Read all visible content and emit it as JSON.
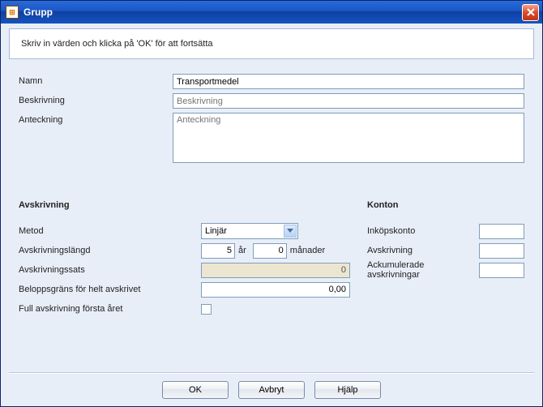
{
  "window": {
    "title": "Grupp"
  },
  "instruction": "Skriv in värden och klicka på 'OK' för att fortsätta",
  "labels": {
    "namn": "Namn",
    "beskrivning": "Beskrivning",
    "anteckning": "Anteckning"
  },
  "values": {
    "namn": "Transportmedel",
    "beskrivning": "",
    "anteckning": ""
  },
  "placeholders": {
    "beskrivning": "Beskrivning",
    "anteckning": "Anteckning"
  },
  "avskrivning": {
    "title": "Avskrivning",
    "metod_label": "Metod",
    "metod_value": "Linjär",
    "langd_label": "Avskrivningslängd",
    "ar_value": "5",
    "ar_unit": "år",
    "man_value": "0",
    "man_unit": "månader",
    "sats_label": "Avskrivningssats",
    "sats_value": "0",
    "belopp_label": "Beloppsgräns för helt avskrivet",
    "belopp_value": "0,00",
    "full_label": "Full avskrivning första året",
    "full_checked": false
  },
  "konton": {
    "title": "Konton",
    "inkop_label": "Inköpskonto",
    "inkop_value": "",
    "avskr_label": "Avskrivning",
    "avskr_value": "",
    "ack_label": "Ackumulerade avskrivningar",
    "ack_value": ""
  },
  "buttons": {
    "ok": "OK",
    "avbryt": "Avbryt",
    "hjalp": "Hjälp"
  }
}
